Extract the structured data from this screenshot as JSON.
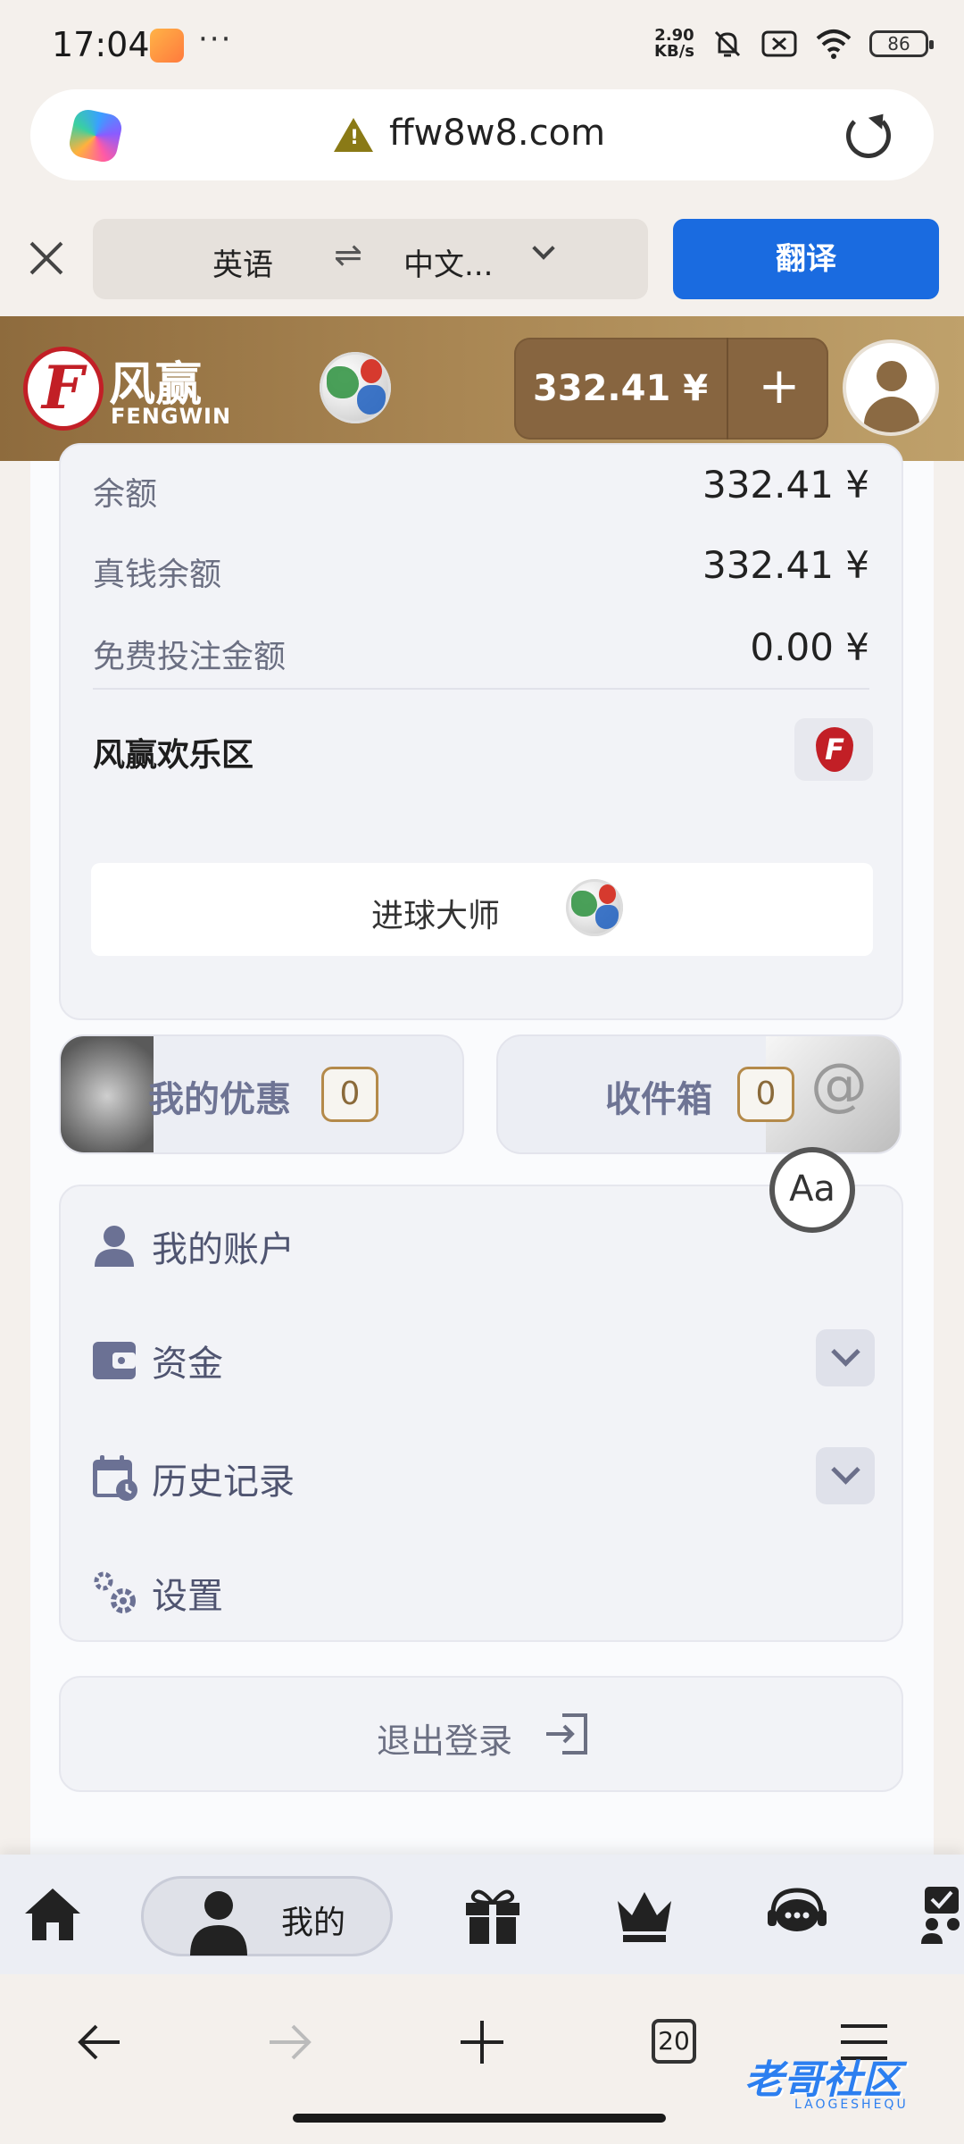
{
  "status_bar": {
    "time": "17:04",
    "speed_value": "2.90",
    "speed_unit": "KB/s",
    "battery": "86",
    "more": "···"
  },
  "url_bar": {
    "url": "ffw8w8.com",
    "warning_glyph": "!"
  },
  "translate_bar": {
    "source_lang": "英语",
    "swap_glyph": "⇌",
    "target_lang": "中文...",
    "translate_button": "翻译"
  },
  "header": {
    "logo_cn": "风赢",
    "logo_en": "FENGWIN",
    "logo_letter": "F",
    "balance": "332.41 ¥",
    "add": "+"
  },
  "balance_card": {
    "rows": [
      {
        "label": "余额",
        "value": "332.41 ¥"
      },
      {
        "label": "真钱余额",
        "value": "332.41 ¥"
      },
      {
        "label": "免费投注金额",
        "value": "0.00 ¥"
      }
    ],
    "happy_zone": "风赢欢乐区",
    "goal_master": "进球大师"
  },
  "promos": {
    "offers_label": "我的优惠",
    "offers_count": "0",
    "inbox_label": "收件箱",
    "inbox_count": "0",
    "inbox_glyph": "@"
  },
  "menu": {
    "account": "我的账户",
    "funds": "资金",
    "history": "历史记录",
    "settings": "设置"
  },
  "logout": "退出登录",
  "text_size_button": "Aa",
  "site_nav": {
    "mine_label": "我的"
  },
  "browser_nav": {
    "tabs_count": "20"
  },
  "watermark": {
    "text": "老哥社区",
    "sub": "LAOGESHEQU"
  },
  "colors": {
    "header_gold": "#a88552",
    "translate_blue": "#1a6be0",
    "brand_red": "#c21f26",
    "menu_text": "#4f5470",
    "badge_border": "#b48a4a"
  }
}
